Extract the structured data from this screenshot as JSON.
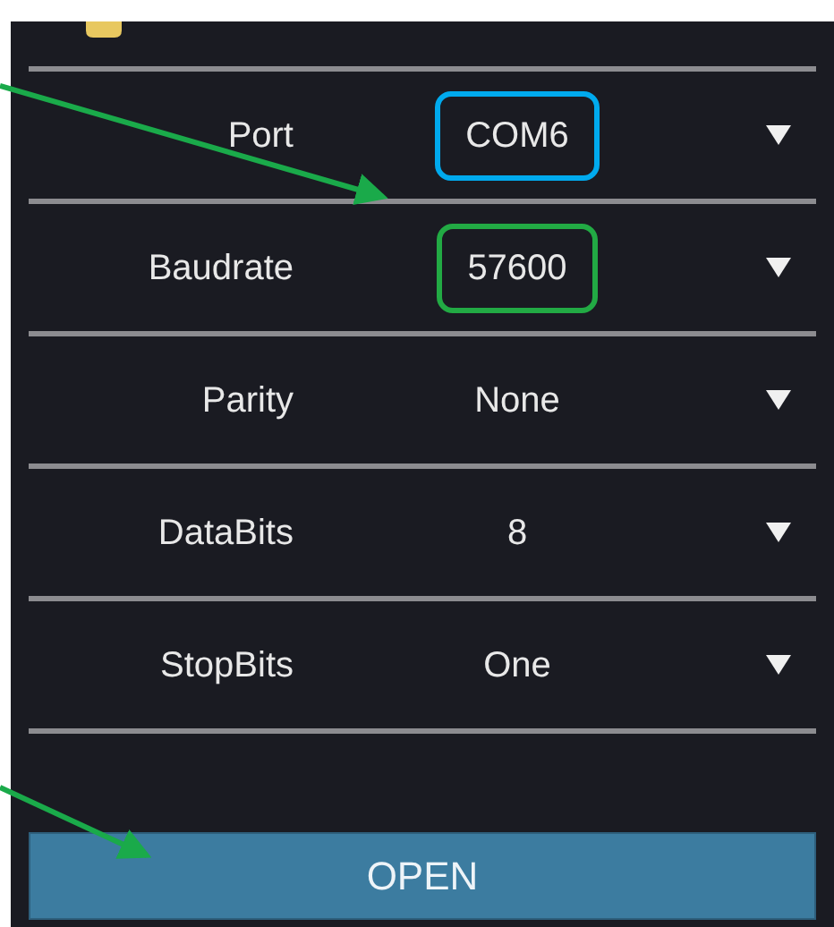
{
  "settings": [
    {
      "label": "Port",
      "value": "COM6",
      "color": "#00aaee"
    },
    {
      "label": "Baudrate",
      "value": "57600",
      "color": "#22aa44"
    },
    {
      "label": "Parity",
      "value": "None"
    },
    {
      "label": "DataBits",
      "value": "8"
    },
    {
      "label": "StopBits",
      "value": "One"
    }
  ],
  "open_button": {
    "label": "OPEN"
  }
}
